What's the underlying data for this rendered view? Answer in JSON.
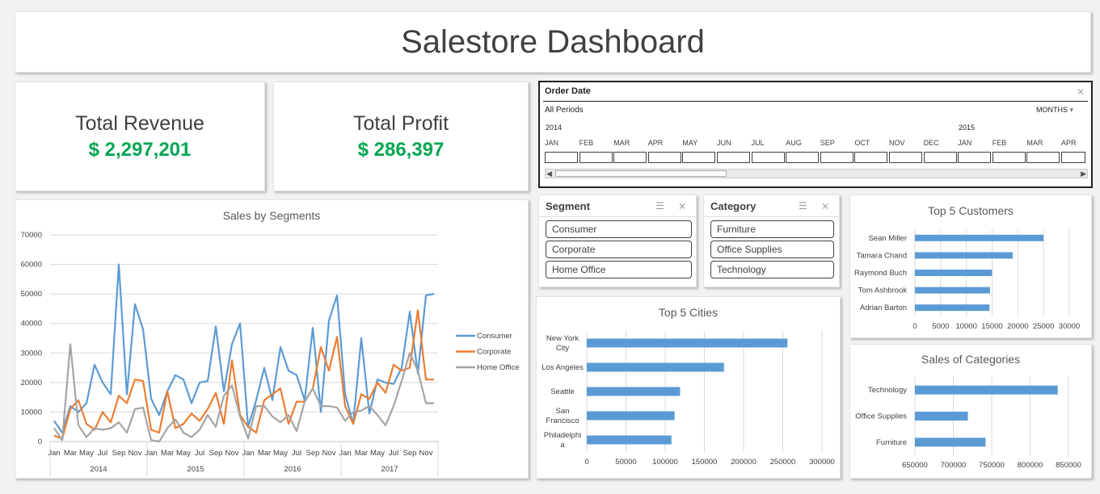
{
  "title": "Salestore Dashboard",
  "kpis": {
    "revenue": {
      "label": "Total Revenue",
      "value": "$ 2,297,201"
    },
    "profit": {
      "label": "Total Profit",
      "value": "$ 286,397"
    }
  },
  "timeline": {
    "header": "Order Date",
    "period": "All Periods",
    "unit": "MONTHS",
    "year1": "2014",
    "year2": "2015",
    "months": [
      "JAN",
      "FEB",
      "MAR",
      "APR",
      "MAY",
      "JUN",
      "JUL",
      "AUG",
      "SEP",
      "OCT",
      "NOV",
      "DEC",
      "JAN",
      "FEB",
      "MAR",
      "APR"
    ]
  },
  "slicers": {
    "segment": {
      "header": "Segment",
      "items": [
        "Consumer",
        "Corporate",
        "Home Office"
      ]
    },
    "category": {
      "header": "Category",
      "items": [
        "Furniture",
        "Office Supplies",
        "Technology"
      ]
    }
  },
  "colors": {
    "accent_green": "#00a651",
    "bar_blue": "#5b9bd5",
    "consumer": "#5b9bd5",
    "corporate": "#ed7d31",
    "home_office": "#a5a5a5"
  },
  "chart_data": [
    {
      "type": "line",
      "title": "Sales by Segments",
      "x_tick_labels": [
        "Jan",
        "Mar",
        "May",
        "Jul",
        "Sep",
        "Nov",
        "Jan",
        "Mar",
        "May",
        "Jul",
        "Sep",
        "Nov",
        "Jan",
        "Mar",
        "May",
        "Jul",
        "Sep",
        "Nov",
        "Jan",
        "Mar",
        "May",
        "Jul",
        "Sep",
        "Nov"
      ],
      "years": [
        "2014",
        "2015",
        "2016",
        "2017"
      ],
      "y_ticks": [
        "0",
        "10000",
        "20000",
        "30000",
        "40000",
        "50000",
        "60000",
        "70000"
      ],
      "ylim": [
        0,
        70000
      ],
      "grid": true,
      "legend": "right",
      "series": [
        {
          "name": "Consumer",
          "values": [
            7000,
            3000,
            12000,
            10000,
            13000,
            26000,
            20000,
            16000,
            60000,
            16000,
            46500,
            38000,
            14500,
            9000,
            17000,
            22500,
            21000,
            13000,
            20000,
            20500,
            39000,
            17000,
            33000,
            40000,
            5000,
            14000,
            25000,
            14000,
            32000,
            24000,
            22500,
            14000,
            38500,
            10000,
            41000,
            49500,
            16000,
            6000,
            35000,
            9500,
            21000,
            20000,
            19500,
            25000,
            44000,
            23000,
            49500,
            50000
          ]
        },
        {
          "name": "Corporate",
          "values": [
            2000,
            1000,
            11000,
            14000,
            6000,
            4000,
            10000,
            6500,
            15500,
            13000,
            21000,
            20500,
            4000,
            3000,
            17000,
            4500,
            6000,
            9500,
            7000,
            11000,
            16500,
            6000,
            27500,
            9000,
            5000,
            3000,
            14000,
            16000,
            18000,
            6000,
            13500,
            13500,
            18000,
            32000,
            24000,
            35500,
            12000,
            6000,
            16000,
            14500,
            20000,
            16500,
            26000,
            24000,
            25000,
            44500,
            21000,
            21000
          ]
        },
        {
          "name": "Home Office",
          "values": [
            4500,
            500,
            33000,
            5500,
            1500,
            4500,
            4000,
            4500,
            6500,
            3000,
            11000,
            11500,
            500,
            0,
            4500,
            7500,
            3000,
            1500,
            4000,
            9000,
            5000,
            15500,
            19000,
            8500,
            1000,
            12000,
            12000,
            8500,
            6500,
            9000,
            3500,
            13500,
            18000,
            12000,
            12000,
            11500,
            7000,
            10000,
            10500,
            12000,
            9000,
            5500,
            12000,
            20500,
            30000,
            24000,
            13000,
            13000
          ]
        }
      ]
    },
    {
      "type": "bar",
      "title": "Top 5 Cities",
      "categories": [
        "New York City",
        "Los Angeles",
        "Seattle",
        "San Francisco",
        "Philadelphia"
      ],
      "values": [
        256000,
        175000,
        119000,
        112000,
        108000
      ],
      "x_ticks": [
        "0",
        "50000",
        "100000",
        "150000",
        "200000",
        "250000",
        "300000"
      ],
      "xlim": [
        0,
        300000
      ]
    },
    {
      "type": "bar",
      "title": "Top 5 Customers",
      "categories": [
        "Sean Miller",
        "Tamara Chand",
        "Raymond Buch",
        "Tom Ashbrook",
        "Adrian Barton"
      ],
      "values": [
        25000,
        19000,
        15000,
        14600,
        14500
      ],
      "x_ticks": [
        "0",
        "5000",
        "10000",
        "15000",
        "20000",
        "25000",
        "30000"
      ],
      "xlim": [
        0,
        30000
      ]
    },
    {
      "type": "bar",
      "title": "Sales of Categories",
      "categories": [
        "Technology",
        "Office Supplies",
        "Furniture"
      ],
      "values": [
        836000,
        719000,
        742000
      ],
      "x_ticks": [
        "650000",
        "700000",
        "750000",
        "800000",
        "850000"
      ],
      "xlim": [
        650000,
        850000
      ]
    }
  ]
}
